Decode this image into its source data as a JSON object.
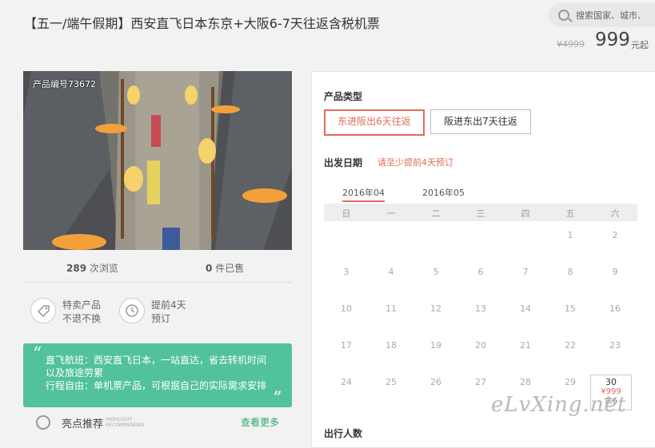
{
  "header": {
    "title": "【五一/端午假期】西安直飞日本东京+大阪6-7天往返含税机票",
    "search_placeholder": "搜索国家、城市、",
    "original_price": "¥4999",
    "price": "999",
    "price_unit": "元起"
  },
  "gallery": {
    "product_code": "产品编号73672"
  },
  "stats": {
    "views_num": "289",
    "views_label": "次浏览",
    "sold_num": "0",
    "sold_label": "件已售"
  },
  "features": [
    {
      "line1": "特卖产品",
      "line2": "不退不换"
    },
    {
      "line1": "提前4天",
      "line2": "预订"
    }
  ],
  "quote": {
    "open": "“",
    "close": "„",
    "line1": "直飞航班：西安直飞日本，一站直达，省去转机时间",
    "line2": "以及旅途劳累",
    "line3": "行程自由：单机票产品，可根据自己的实际需求安排"
  },
  "highlight": {
    "title": "亮点推荐",
    "en1": "HIGHLIGHT",
    "en2": "RECOMMENDED",
    "more": "查看更多"
  },
  "booking": {
    "product_type_label": "产品类型",
    "options": [
      "东进阪出6天往返",
      "阪进东出7天往返"
    ],
    "date_label": "出发日期",
    "date_hint": "请至少提前4天预订",
    "months": [
      "2016年04",
      "2016年05"
    ],
    "weekdays": [
      "日",
      "一",
      "二",
      "三",
      "四",
      "五",
      "六"
    ],
    "days": [
      "1",
      "2",
      "3",
      "4",
      "5",
      "6",
      "7",
      "8",
      "9",
      "10",
      "11",
      "12",
      "13",
      "14",
      "15",
      "16",
      "17",
      "18",
      "19",
      "20",
      "21",
      "22",
      "23",
      "24",
      "25",
      "26",
      "27",
      "28",
      "29"
    ],
    "special_day": {
      "num": "30",
      "price": "¥999",
      "stock": "余6"
    },
    "travelers_label": "出行人数"
  },
  "watermark": "eLvXing.net",
  "colors": {
    "accent": "#e36b5a",
    "green": "#52c29a",
    "link_green": "#2ea870"
  }
}
